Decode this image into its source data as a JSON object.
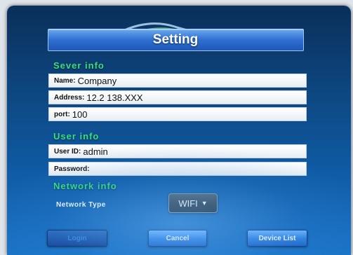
{
  "header": {
    "title": "Setting"
  },
  "server_info": {
    "section_title": "Sever info",
    "name": {
      "label": "Name:",
      "value": "Company"
    },
    "address": {
      "label": "Address:",
      "value": "12.2 138.XXX"
    },
    "port": {
      "label": "port:",
      "value": "100"
    }
  },
  "user_info": {
    "section_title": "User info",
    "user_id": {
      "label": "User ID:",
      "value": "admin"
    },
    "password": {
      "label": "Password:",
      "value": ""
    }
  },
  "network_info": {
    "section_title": "Network info",
    "type_label": "Network Type",
    "type_value": "WIFI",
    "dropdown_icon": "triangle-down-icon"
  },
  "buttons": {
    "login": "Login",
    "cancel": "Cancel",
    "device_list": "Device List"
  },
  "colors": {
    "section_title": "#38e07a",
    "background": "#0e4a86",
    "button": "#2f80e0"
  }
}
